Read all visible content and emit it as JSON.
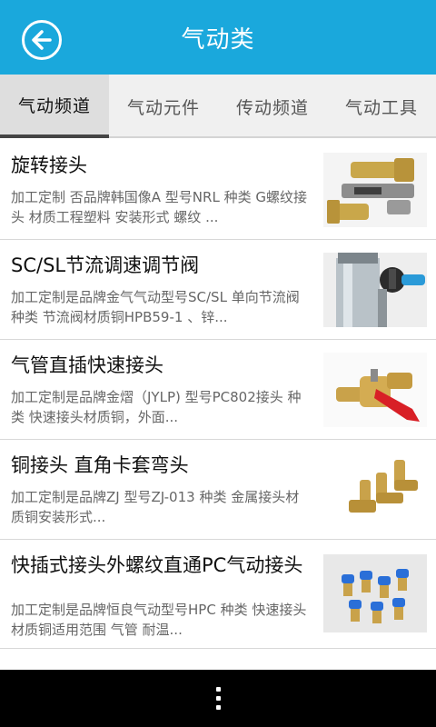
{
  "header": {
    "title": "气动类",
    "back_icon": "back-arrow-circle-icon",
    "color": "#1aa8dc"
  },
  "tabs": [
    {
      "label": "气动频道",
      "active": true
    },
    {
      "label": "气动元件",
      "active": false
    },
    {
      "label": "传动频道",
      "active": false
    },
    {
      "label": "气动工具",
      "active": false
    }
  ],
  "products": [
    {
      "title": "旋转接头",
      "desc": "加工定制 否品牌韩国像A  型号NRL 种类 G螺纹接头 材质工程塑料 安装形式 螺纹 ..."
    },
    {
      "title": "SC/SL节流调速调节阀",
      "desc": "加工定制是品牌金气气动型号SC/SL 单向节流阀 种类 节流阀材质铜HPB59-1 、锌..."
    },
    {
      "title": "气管直插快速接头",
      "desc": "加工定制是品牌金熠（JYLP) 型号PC802接头 种类 快速接头材质铜，外面..."
    },
    {
      "title": "铜接头 直角卡套弯头",
      "desc": "加工定制是品牌ZJ 型号ZJ-013 种类 金属接头材质铜安装形式..."
    },
    {
      "title": "快插式接头外螺纹直通PC气动接头",
      "desc": "加工定制是品牌恒良气动型号HPC 种类 快速接头材质铜适用范围 气管 耐温..."
    }
  ],
  "navbar": {
    "menu_icon": "overflow-menu-icon"
  }
}
